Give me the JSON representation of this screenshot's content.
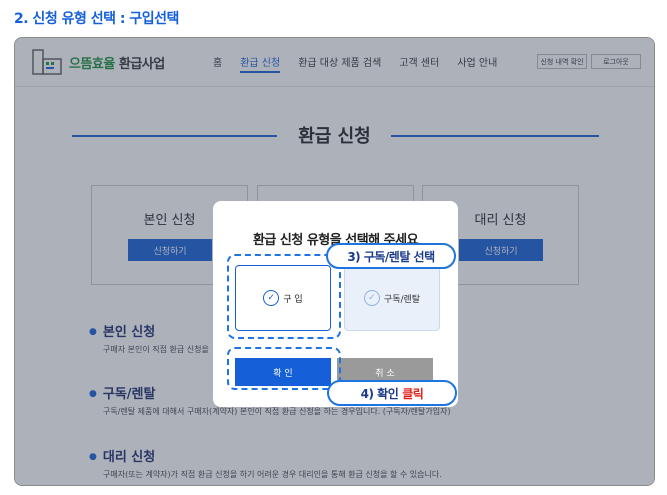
{
  "step_title": "2. 신청 유형 선택 : 구입선택",
  "header": {
    "brand_prefix": "으뜸효율",
    "brand_suffix": " 환급사업",
    "nav": [
      "홈",
      "환급 신청",
      "환급 대상 제품 검색",
      "고객 센터",
      "사업 안내"
    ],
    "active_nav": "환급 신청",
    "history_button": "신청 내역 확인",
    "logout_button": "로그아웃"
  },
  "page": {
    "heading": "환급 신청",
    "cards": [
      {
        "title": "본인 신청",
        "button": "신청하기"
      },
      {
        "title": "",
        "button": ""
      },
      {
        "title": "대리 신청",
        "button": "신청하기"
      }
    ],
    "sections": [
      {
        "title": "본인 신청",
        "desc": "구매자 본인이 직접 환급 신청을"
      },
      {
        "title": "구독/렌탈",
        "desc": "구독/렌탈 제품에 대해서 구매자(계약자) 본인이 직접 환급 신청을 하는 경우입니다. (구독자/렌탈가입자)"
      },
      {
        "title": "대리 신청",
        "desc": "구매자(또는 계약자)가 직접 환급 신청을 하기 어려운 경우 대리인을 통해 환급 신청을 할 수 있습니다."
      }
    ]
  },
  "modal": {
    "title": "환급 신청 유형을 선택해 주세요",
    "option_buy": "구 입",
    "option_subscription": "구독/렌탈",
    "confirm": "확 인",
    "cancel": "취 소"
  },
  "callouts": {
    "step3": "3) 구독/렌탈 선택",
    "step4_prefix": "4) 확인",
    "step4_highlight": "클릭"
  },
  "colors": {
    "accent": "#1560d8",
    "highlight": "#e0201a",
    "brand_green": "#1a8f3c"
  }
}
